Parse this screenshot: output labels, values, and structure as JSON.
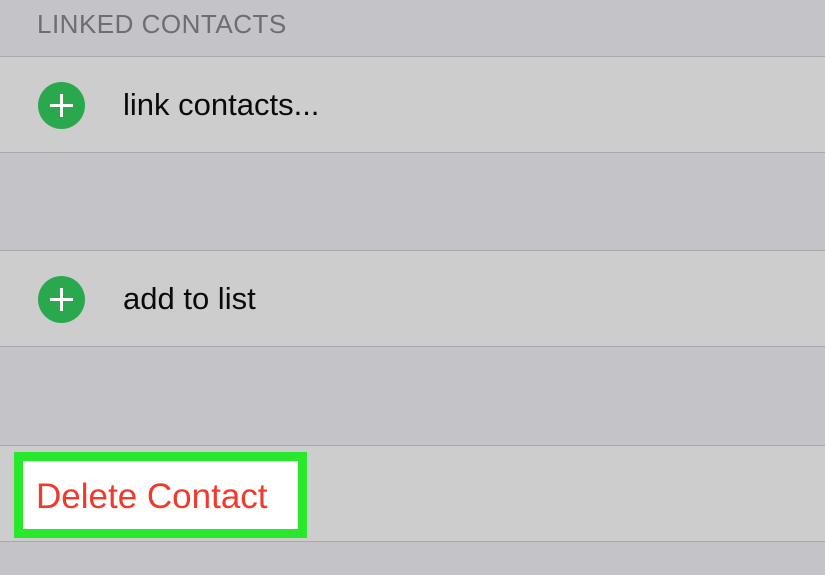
{
  "sections": {
    "linked_contacts_header": "LINKED CONTACTS"
  },
  "rows": {
    "link_contacts": {
      "label": "link contacts...",
      "icon": "plus-circle-icon"
    },
    "add_to_list": {
      "label": "add to list",
      "icon": "plus-circle-icon"
    },
    "delete_contact": {
      "label": "Delete Contact"
    }
  },
  "colors": {
    "background": "#c4c3c8",
    "row_background": "#cdcdcd",
    "icon_green": "#2aa84e",
    "destructive_red": "#ef3a2c",
    "highlight_green": "#27e82b"
  }
}
